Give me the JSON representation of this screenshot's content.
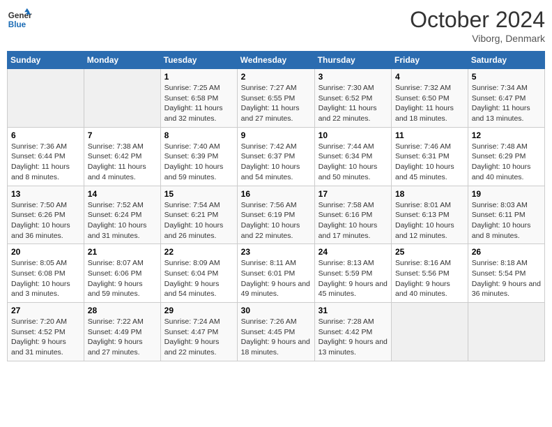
{
  "header": {
    "logo_line1": "General",
    "logo_line2": "Blue",
    "month": "October 2024",
    "location": "Viborg, Denmark"
  },
  "columns": [
    "Sunday",
    "Monday",
    "Tuesday",
    "Wednesday",
    "Thursday",
    "Friday",
    "Saturday"
  ],
  "weeks": [
    [
      {
        "day": "",
        "sunrise": "",
        "sunset": "",
        "daylight": ""
      },
      {
        "day": "",
        "sunrise": "",
        "sunset": "",
        "daylight": ""
      },
      {
        "day": "1",
        "sunrise": "Sunrise: 7:25 AM",
        "sunset": "Sunset: 6:58 PM",
        "daylight": "Daylight: 11 hours and 32 minutes."
      },
      {
        "day": "2",
        "sunrise": "Sunrise: 7:27 AM",
        "sunset": "Sunset: 6:55 PM",
        "daylight": "Daylight: 11 hours and 27 minutes."
      },
      {
        "day": "3",
        "sunrise": "Sunrise: 7:30 AM",
        "sunset": "Sunset: 6:52 PM",
        "daylight": "Daylight: 11 hours and 22 minutes."
      },
      {
        "day": "4",
        "sunrise": "Sunrise: 7:32 AM",
        "sunset": "Sunset: 6:50 PM",
        "daylight": "Daylight: 11 hours and 18 minutes."
      },
      {
        "day": "5",
        "sunrise": "Sunrise: 7:34 AM",
        "sunset": "Sunset: 6:47 PM",
        "daylight": "Daylight: 11 hours and 13 minutes."
      }
    ],
    [
      {
        "day": "6",
        "sunrise": "Sunrise: 7:36 AM",
        "sunset": "Sunset: 6:44 PM",
        "daylight": "Daylight: 11 hours and 8 minutes."
      },
      {
        "day": "7",
        "sunrise": "Sunrise: 7:38 AM",
        "sunset": "Sunset: 6:42 PM",
        "daylight": "Daylight: 11 hours and 4 minutes."
      },
      {
        "day": "8",
        "sunrise": "Sunrise: 7:40 AM",
        "sunset": "Sunset: 6:39 PM",
        "daylight": "Daylight: 10 hours and 59 minutes."
      },
      {
        "day": "9",
        "sunrise": "Sunrise: 7:42 AM",
        "sunset": "Sunset: 6:37 PM",
        "daylight": "Daylight: 10 hours and 54 minutes."
      },
      {
        "day": "10",
        "sunrise": "Sunrise: 7:44 AM",
        "sunset": "Sunset: 6:34 PM",
        "daylight": "Daylight: 10 hours and 50 minutes."
      },
      {
        "day": "11",
        "sunrise": "Sunrise: 7:46 AM",
        "sunset": "Sunset: 6:31 PM",
        "daylight": "Daylight: 10 hours and 45 minutes."
      },
      {
        "day": "12",
        "sunrise": "Sunrise: 7:48 AM",
        "sunset": "Sunset: 6:29 PM",
        "daylight": "Daylight: 10 hours and 40 minutes."
      }
    ],
    [
      {
        "day": "13",
        "sunrise": "Sunrise: 7:50 AM",
        "sunset": "Sunset: 6:26 PM",
        "daylight": "Daylight: 10 hours and 36 minutes."
      },
      {
        "day": "14",
        "sunrise": "Sunrise: 7:52 AM",
        "sunset": "Sunset: 6:24 PM",
        "daylight": "Daylight: 10 hours and 31 minutes."
      },
      {
        "day": "15",
        "sunrise": "Sunrise: 7:54 AM",
        "sunset": "Sunset: 6:21 PM",
        "daylight": "Daylight: 10 hours and 26 minutes."
      },
      {
        "day": "16",
        "sunrise": "Sunrise: 7:56 AM",
        "sunset": "Sunset: 6:19 PM",
        "daylight": "Daylight: 10 hours and 22 minutes."
      },
      {
        "day": "17",
        "sunrise": "Sunrise: 7:58 AM",
        "sunset": "Sunset: 6:16 PM",
        "daylight": "Daylight: 10 hours and 17 minutes."
      },
      {
        "day": "18",
        "sunrise": "Sunrise: 8:01 AM",
        "sunset": "Sunset: 6:13 PM",
        "daylight": "Daylight: 10 hours and 12 minutes."
      },
      {
        "day": "19",
        "sunrise": "Sunrise: 8:03 AM",
        "sunset": "Sunset: 6:11 PM",
        "daylight": "Daylight: 10 hours and 8 minutes."
      }
    ],
    [
      {
        "day": "20",
        "sunrise": "Sunrise: 8:05 AM",
        "sunset": "Sunset: 6:08 PM",
        "daylight": "Daylight: 10 hours and 3 minutes."
      },
      {
        "day": "21",
        "sunrise": "Sunrise: 8:07 AM",
        "sunset": "Sunset: 6:06 PM",
        "daylight": "Daylight: 9 hours and 59 minutes."
      },
      {
        "day": "22",
        "sunrise": "Sunrise: 8:09 AM",
        "sunset": "Sunset: 6:04 PM",
        "daylight": "Daylight: 9 hours and 54 minutes."
      },
      {
        "day": "23",
        "sunrise": "Sunrise: 8:11 AM",
        "sunset": "Sunset: 6:01 PM",
        "daylight": "Daylight: 9 hours and 49 minutes."
      },
      {
        "day": "24",
        "sunrise": "Sunrise: 8:13 AM",
        "sunset": "Sunset: 5:59 PM",
        "daylight": "Daylight: 9 hours and 45 minutes."
      },
      {
        "day": "25",
        "sunrise": "Sunrise: 8:16 AM",
        "sunset": "Sunset: 5:56 PM",
        "daylight": "Daylight: 9 hours and 40 minutes."
      },
      {
        "day": "26",
        "sunrise": "Sunrise: 8:18 AM",
        "sunset": "Sunset: 5:54 PM",
        "daylight": "Daylight: 9 hours and 36 minutes."
      }
    ],
    [
      {
        "day": "27",
        "sunrise": "Sunrise: 7:20 AM",
        "sunset": "Sunset: 4:52 PM",
        "daylight": "Daylight: 9 hours and 31 minutes."
      },
      {
        "day": "28",
        "sunrise": "Sunrise: 7:22 AM",
        "sunset": "Sunset: 4:49 PM",
        "daylight": "Daylight: 9 hours and 27 minutes."
      },
      {
        "day": "29",
        "sunrise": "Sunrise: 7:24 AM",
        "sunset": "Sunset: 4:47 PM",
        "daylight": "Daylight: 9 hours and 22 minutes."
      },
      {
        "day": "30",
        "sunrise": "Sunrise: 7:26 AM",
        "sunset": "Sunset: 4:45 PM",
        "daylight": "Daylight: 9 hours and 18 minutes."
      },
      {
        "day": "31",
        "sunrise": "Sunrise: 7:28 AM",
        "sunset": "Sunset: 4:42 PM",
        "daylight": "Daylight: 9 hours and 13 minutes."
      },
      {
        "day": "",
        "sunrise": "",
        "sunset": "",
        "daylight": ""
      },
      {
        "day": "",
        "sunrise": "",
        "sunset": "",
        "daylight": ""
      }
    ]
  ]
}
